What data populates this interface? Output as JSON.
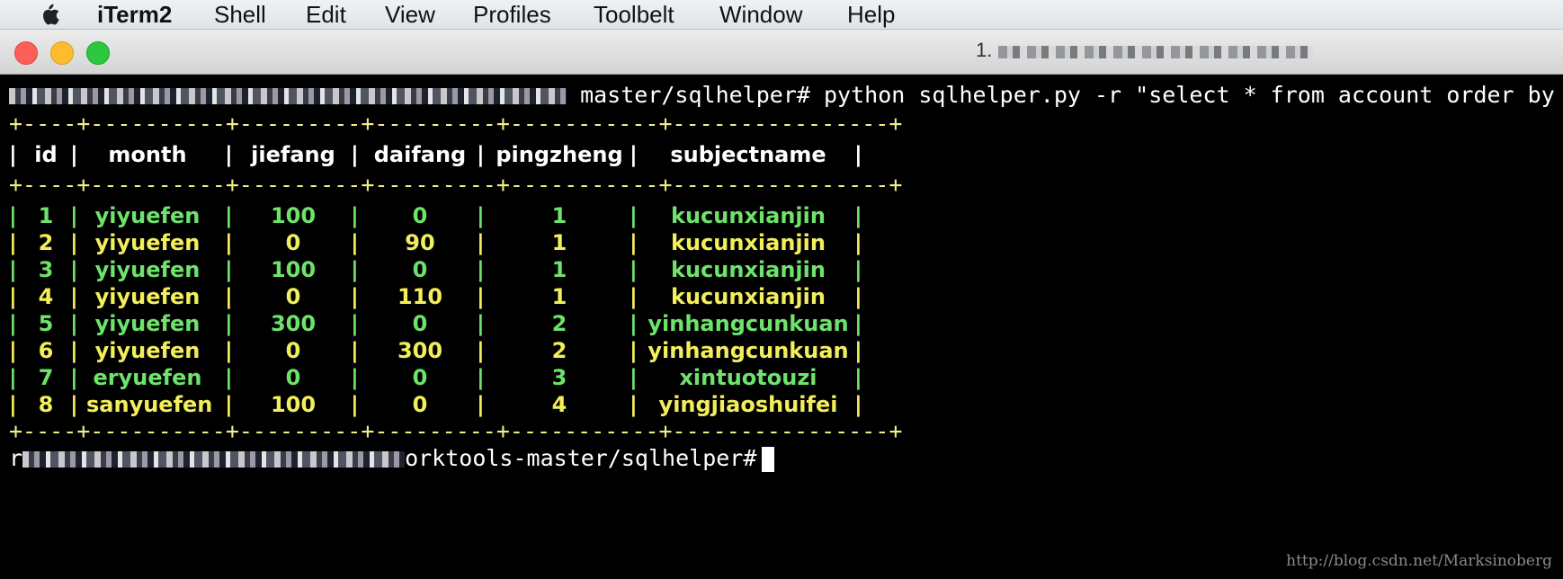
{
  "menubar": {
    "app": "iTerm2",
    "items": [
      "Shell",
      "Edit",
      "View",
      "Profiles",
      "Toolbelt",
      "Window",
      "Help"
    ]
  },
  "window": {
    "title_prefix": "1."
  },
  "terminal": {
    "command_line": "master/sqlhelper# python sqlhelper.py -r \"select * from account order by id\"",
    "border": "+----+----------+---------+---------+-----------+----------------+",
    "headers": [
      "id",
      "month",
      "jiefang",
      "daifang",
      "pingzheng",
      "subjectname"
    ],
    "rows": [
      {
        "id": "1",
        "month": "yiyuefen",
        "jiefang": "100",
        "daifang": "0",
        "pingzheng": "1",
        "subjectname": "kucunxianjin",
        "color": "green"
      },
      {
        "id": "2",
        "month": "yiyuefen",
        "jiefang": "0",
        "daifang": "90",
        "pingzheng": "1",
        "subjectname": "kucunxianjin",
        "color": "yellow"
      },
      {
        "id": "3",
        "month": "yiyuefen",
        "jiefang": "100",
        "daifang": "0",
        "pingzheng": "1",
        "subjectname": "kucunxianjin",
        "color": "green"
      },
      {
        "id": "4",
        "month": "yiyuefen",
        "jiefang": "0",
        "daifang": "110",
        "pingzheng": "1",
        "subjectname": "kucunxianjin",
        "color": "yellow"
      },
      {
        "id": "5",
        "month": "yiyuefen",
        "jiefang": "300",
        "daifang": "0",
        "pingzheng": "2",
        "subjectname": "yinhangcunkuan",
        "color": "green"
      },
      {
        "id": "6",
        "month": "yiyuefen",
        "jiefang": "0",
        "daifang": "300",
        "pingzheng": "2",
        "subjectname": "yinhangcunkuan",
        "color": "yellow"
      },
      {
        "id": "7",
        "month": "eryuefen",
        "jiefang": "0",
        "daifang": "0",
        "pingzheng": "3",
        "subjectname": "xintuotouzi",
        "color": "green"
      },
      {
        "id": "8",
        "month": "sanyuefen",
        "jiefang": "100",
        "daifang": "0",
        "pingzheng": "4",
        "subjectname": "yingjiaoshuifei",
        "color": "yellow"
      }
    ],
    "prompt": "orktools-master/sqlhelper#",
    "prompt_prefix": "r"
  },
  "watermark": "http://blog.csdn.net/Marksinoberg",
  "colors": {
    "green": "#6ee36b",
    "yellow": "#f2ee5c",
    "background": "#000000"
  }
}
